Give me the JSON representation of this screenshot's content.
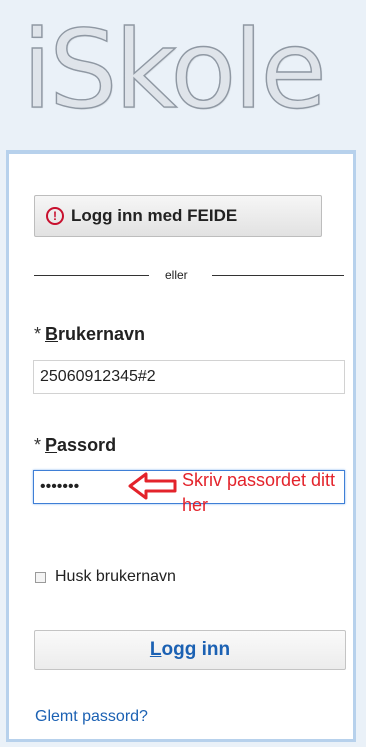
{
  "logo": {
    "text": "iSkole"
  },
  "login": {
    "feide_button": {
      "icon": "info-circle-icon",
      "label": "Logg inn med FEIDE"
    },
    "divider_text": "eller",
    "username": {
      "required_mark": "*",
      "access_key": "B",
      "label_rest": "rukernavn",
      "value": "25060912345#2"
    },
    "password": {
      "required_mark": "*",
      "access_key": "P",
      "label_rest": "assord",
      "value": "•••••••"
    },
    "annotation": {
      "text": "Skriv passordet ditt her",
      "color": "#e3232b",
      "icon": "left-arrow-icon"
    },
    "remember": {
      "label": "Husk brukernavn",
      "checked": false
    },
    "login_button": {
      "access_key": "L",
      "label_rest": "ogg inn"
    },
    "forgot_link": "Glemt passord?"
  },
  "colors": {
    "accent": "#1b61b3",
    "panel_border": "#b7d1ec",
    "background": "#eaf1f8",
    "warning": "#c8102e"
  }
}
